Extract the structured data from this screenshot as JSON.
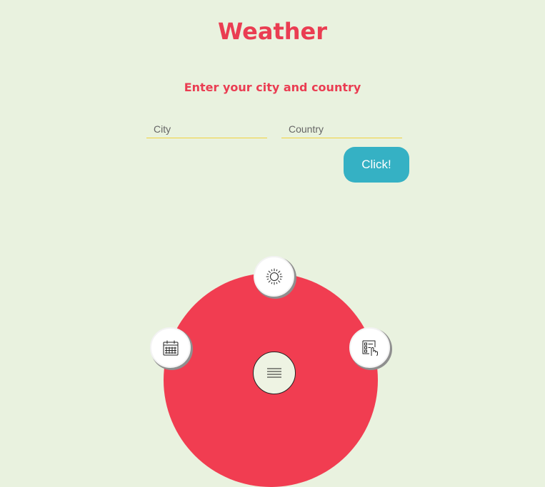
{
  "header": {
    "title": "Weather",
    "subtitle": "Enter your city and country"
  },
  "form": {
    "city_placeholder": "City",
    "country_placeholder": "Country",
    "submit_label": "Click!"
  },
  "menu": {
    "items": [
      {
        "icon": "sun-icon"
      },
      {
        "icon": "calendar-icon"
      },
      {
        "icon": "forecast-icon"
      }
    ],
    "toggle_icon": "hamburger-icon"
  },
  "colors": {
    "background": "#e9f2df",
    "accent": "#ea3d52",
    "menu_disc": "#f13d51",
    "button": "#35b1c4",
    "input_underline": "#f0d23c"
  }
}
